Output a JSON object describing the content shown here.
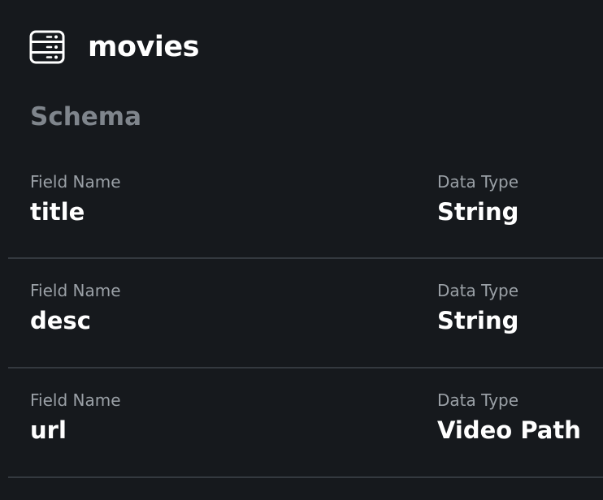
{
  "header": {
    "icon": "database-icon",
    "title": "movies"
  },
  "schema": {
    "title": "Schema",
    "field_name_label": "Field Name",
    "data_type_label": "Data Type",
    "fields": [
      {
        "name": "title",
        "type": "String"
      },
      {
        "name": "desc",
        "type": "String"
      },
      {
        "name": "url",
        "type": "Video Path"
      }
    ]
  },
  "colors": {
    "background": "#16191d",
    "muted_heading": "#7f858c",
    "label": "#9aa0a6",
    "divider": "#34393f",
    "text": "#ffffff"
  }
}
